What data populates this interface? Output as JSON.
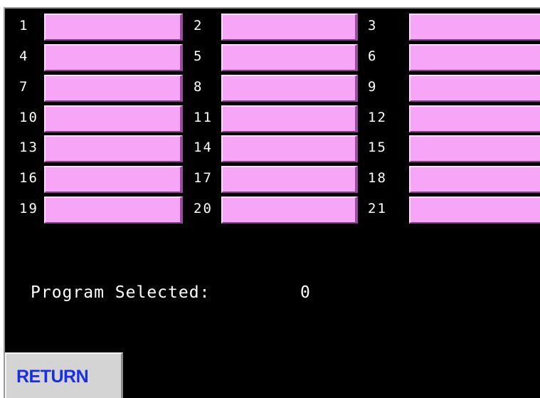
{
  "colors": {
    "background": "#000000",
    "slot_button": "#f7a6f7",
    "return_text": "#1a2ee0",
    "return_button": "#d4d4d4"
  },
  "program_slots": [
    {
      "number": "1"
    },
    {
      "number": "2"
    },
    {
      "number": "3"
    },
    {
      "number": "4"
    },
    {
      "number": "5"
    },
    {
      "number": "6"
    },
    {
      "number": "7"
    },
    {
      "number": "8"
    },
    {
      "number": "9"
    },
    {
      "number": "10"
    },
    {
      "number": "11"
    },
    {
      "number": "12"
    },
    {
      "number": "13"
    },
    {
      "number": "14"
    },
    {
      "number": "15"
    },
    {
      "number": "16"
    },
    {
      "number": "17"
    },
    {
      "number": "18"
    },
    {
      "number": "19"
    },
    {
      "number": "20"
    },
    {
      "number": "21"
    }
  ],
  "status": {
    "label": "Program Selected:",
    "value": "0"
  },
  "return_button": {
    "label": "RETURN"
  }
}
